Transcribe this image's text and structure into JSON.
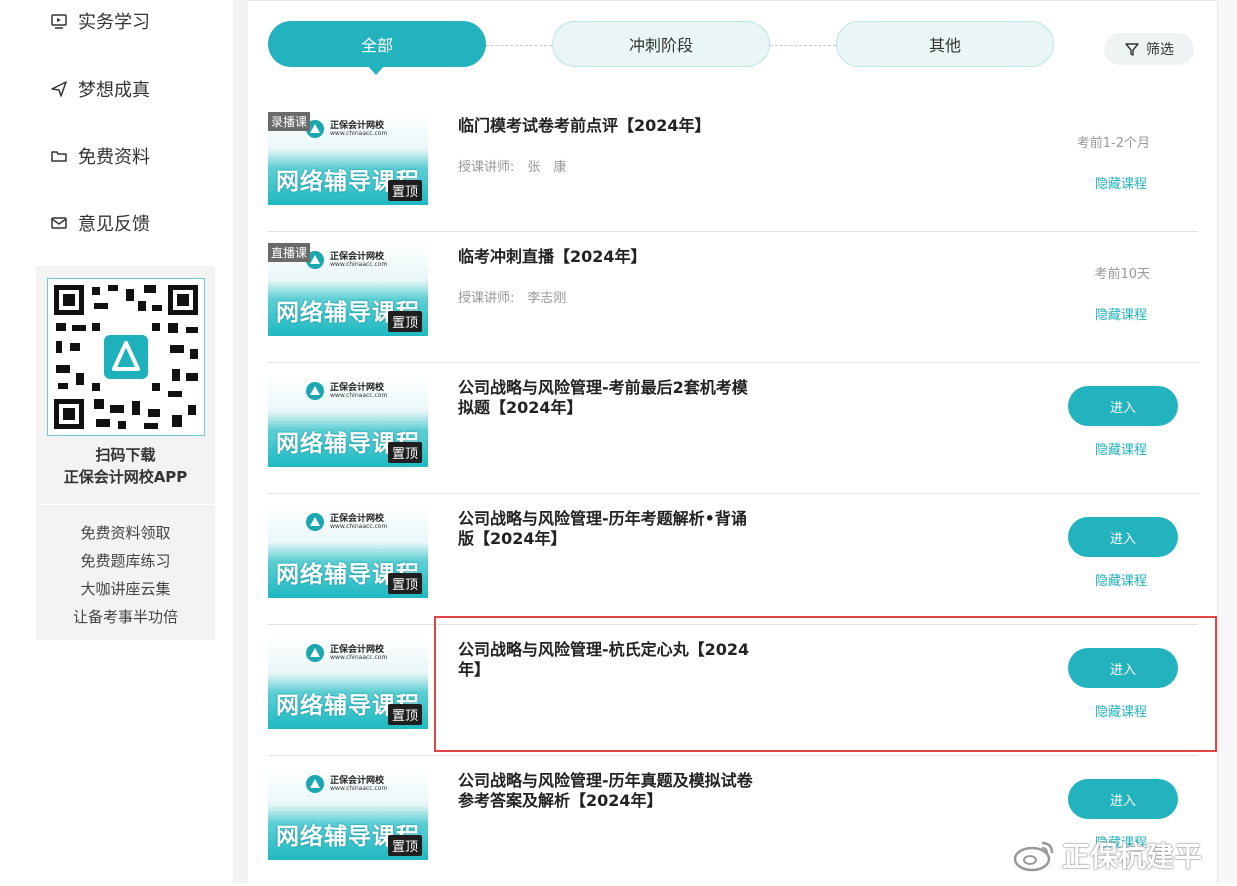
{
  "sidebar": {
    "items": [
      {
        "label": "实务学习",
        "icon": "monitor-icon"
      },
      {
        "label": "梦想成真",
        "icon": "paper-plane-icon"
      },
      {
        "label": "免费资料",
        "icon": "folder-icon"
      },
      {
        "label": "意见反馈",
        "icon": "mail-icon"
      }
    ],
    "qr": {
      "line1": "扫码下载",
      "line2": "正保会计网校APP",
      "links": [
        "免费资料领取",
        "免费题库练习",
        "大咖讲座云集",
        "让备考事半功倍"
      ]
    }
  },
  "tabs": [
    {
      "label": "全部",
      "active": true
    },
    {
      "label": "冲刺阶段",
      "active": false
    },
    {
      "label": "其他",
      "active": false
    }
  ],
  "filter_label": "筛选",
  "thumb": {
    "school": "正保会计网校",
    "url": "www.chinaacc.com",
    "banner": "网络辅导课程",
    "pin": "置顶"
  },
  "courses": [
    {
      "tag": "录播课",
      "title": "临门模考试卷考前点评【2024年】",
      "teacher": "授课讲师:　张　康",
      "time": "考前1-2个月",
      "hide": "隐藏课程"
    },
    {
      "tag": "直播课",
      "title": "临考冲刺直播【2024年】",
      "teacher": "授课讲师:　李志刚",
      "time": "考前10天",
      "hide": "隐藏课程"
    },
    {
      "title": "公司战略与风险管理-考前最后2套机考模拟题【2024年】",
      "enter": "进入",
      "hide": "隐藏课程"
    },
    {
      "title": "公司战略与风险管理-历年考题解析•背诵版【2024年】",
      "enter": "进入",
      "hide": "隐藏课程"
    },
    {
      "title": "公司战略与风险管理-杭氏定心丸【2024年】",
      "enter": "进入",
      "hide": "隐藏课程"
    },
    {
      "title": "公司战略与风险管理-历年真题及模拟试卷 参考答案及解析【2024年】",
      "enter": "进入",
      "hide": "隐藏课程"
    }
  ],
  "watermark": "正保杭建平",
  "colors": {
    "accent": "#23b3be",
    "highlight": "#e04545"
  }
}
